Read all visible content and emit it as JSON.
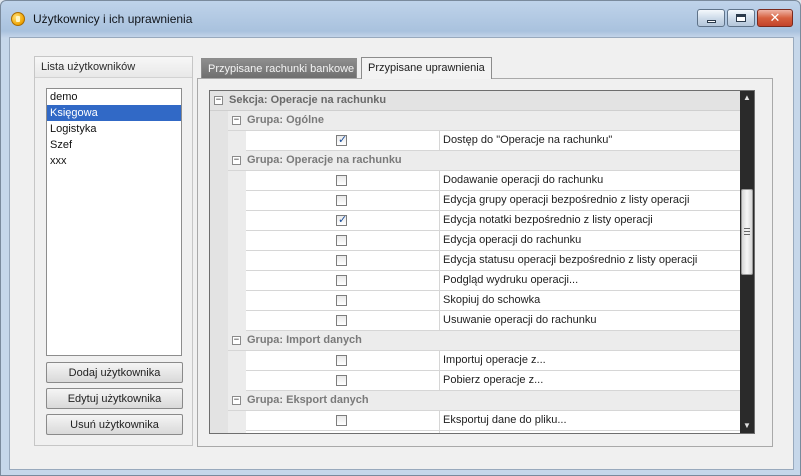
{
  "window": {
    "title": "Użytkownicy i ich uprawnienia"
  },
  "users": {
    "header": "Lista użytkowników",
    "items": [
      "demo",
      "Księgowa",
      "Logistyka",
      "Szef",
      "xxx"
    ],
    "selected": "Księgowa",
    "buttons": {
      "add": "Dodaj użytkownika",
      "edit": "Edytuj użytkownika",
      "remove": "Usuń użytkownika"
    }
  },
  "tabs": [
    {
      "label": "Przypisane rachunki bankowe",
      "active": false
    },
    {
      "label": "Przypisane uprawnienia",
      "active": true
    }
  ],
  "permissions": {
    "section": "Sekcja: Operacje na rachunku",
    "groups": [
      {
        "name": "Grupa: Ogólne",
        "items": [
          {
            "label": "Dostęp do \"Operacje na rachunku\"",
            "checked": true
          }
        ]
      },
      {
        "name": "Grupa: Operacje na rachunku",
        "items": [
          {
            "label": "Dodawanie operacji do rachunku",
            "checked": false
          },
          {
            "label": "Edycja grupy operacji bezpośrednio z listy operacji",
            "checked": false
          },
          {
            "label": "Edycja notatki bezpośrednio z listy operacji",
            "checked": true
          },
          {
            "label": "Edycja operacji do rachunku",
            "checked": false
          },
          {
            "label": "Edycja statusu operacji bezpośrednio z listy operacji",
            "checked": false
          },
          {
            "label": "Podgląd wydruku operacji...",
            "checked": false
          },
          {
            "label": "Skopiuj do schowka",
            "checked": false
          },
          {
            "label": "Usuwanie operacji do rachunku",
            "checked": false
          }
        ]
      },
      {
        "name": "Grupa: Import danych",
        "items": [
          {
            "label": "Importuj operacje z...",
            "checked": false
          },
          {
            "label": "Pobierz operacje z...",
            "checked": false
          }
        ]
      },
      {
        "name": "Grupa: Eksport danych",
        "items": [
          {
            "label": "Eksportuj dane do pliku...",
            "checked": false
          },
          {
            "label": "",
            "checked": false
          }
        ]
      }
    ]
  },
  "icons": {
    "app": "app-icon",
    "minimize": "minimize-icon",
    "maximize": "maximize-icon",
    "close": "close-icon",
    "expander": "collapse-icon",
    "check": "check-icon",
    "scroll_up": "scroll-up-icon",
    "scroll_down": "scroll-down-icon"
  }
}
